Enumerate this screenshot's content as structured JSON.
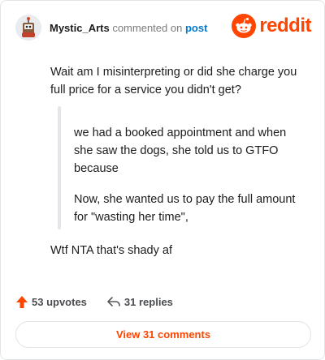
{
  "header": {
    "username": "Mystic_Arts",
    "action_text": "commented on",
    "post_link": "post",
    "brand": "reddit"
  },
  "comment": {
    "intro": "Wait am I misinterpreting or did she charge you full price for a service you didn't get?",
    "quote_paragraphs": [
      "we had a booked appointment and when she saw the dogs, she told us to GTFO because",
      "Now, she wanted us to pay the full amount for \"wasting her time\","
    ],
    "outro": "Wtf NTA that's shady af"
  },
  "stats": {
    "upvotes": "53 upvotes",
    "replies": "31 replies"
  },
  "view_comments_label": "View 31 comments",
  "colors": {
    "brand": "#ff4500",
    "link": "#0079d3",
    "muted": "#7c7c7c",
    "quote_bar": "#e4e6e9"
  },
  "icons": {
    "upvote": "upvote-arrow-icon",
    "reply": "reply-arrow-icon",
    "logo": "reddit-snoo-icon"
  }
}
